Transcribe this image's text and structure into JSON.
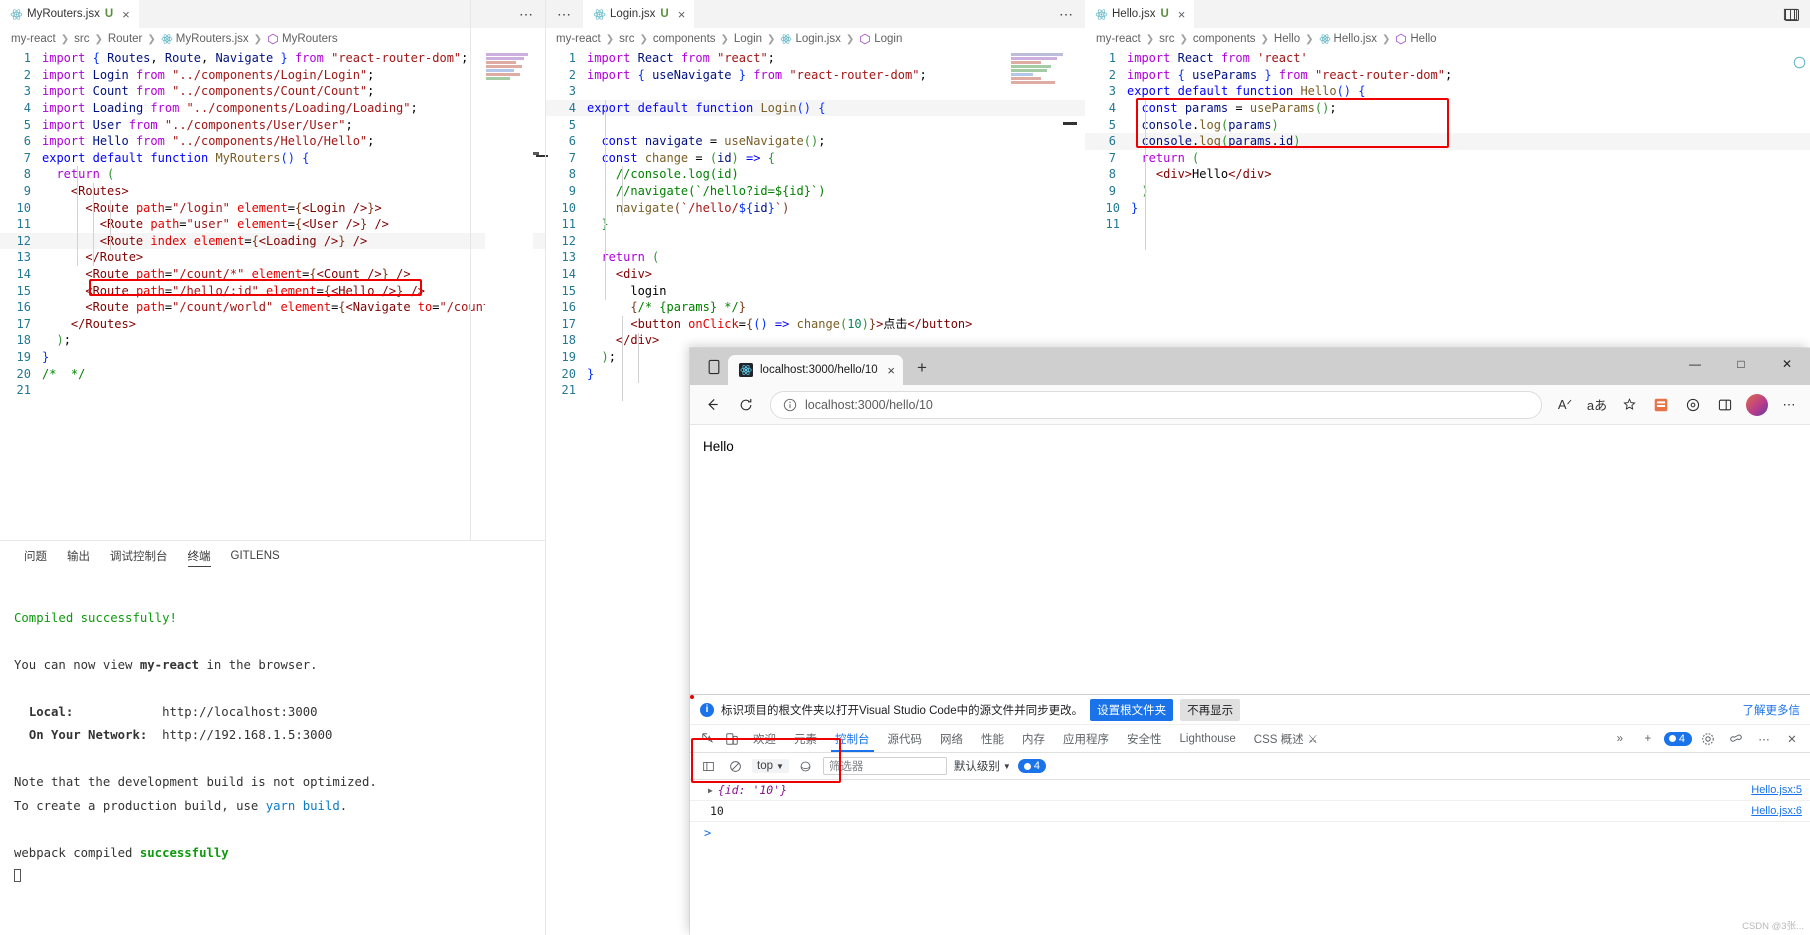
{
  "editor_groups": [
    {
      "id": "group-myrouters",
      "tab": {
        "filename": "MyRouters.jsx",
        "unsaved_marker": "U",
        "close": "×",
        "icon": "react-icon"
      },
      "more_actions": "⋯",
      "breadcrumb": [
        "my-react",
        "src",
        "Router",
        "MyRouters.jsx",
        "MyRouters"
      ],
      "lines": [
        "import { Routes, Route, Navigate } from \"react-router-dom\";",
        "import Login from \"../components/Login/Login\";",
        "import Count from \"../components/Count/Count\";",
        "import Loading from \"../components/Loading/Loading\";",
        "import User from \"../components/User/User\";",
        "import Hello from \"../components/Hello/Hello\";",
        "export default function MyRouters() {",
        "  return (",
        "    <Routes>",
        "      <Route path=\"/login\" element={<Login />}>",
        "        <Route path=\"user\" element={<User />} />",
        "        <Route index element={{<Loading />} />",
        "      </Route>",
        "      <Route path=\"/count/*\" element={<Count />} />",
        "      <Route path=\"/hello/:id\" element={<Hello />} />",
        "      <Route path=\"/count/world\" element={<Navigate to=\"/count",
        "    </Routes>",
        "  );",
        "}",
        "/*  */",
        ""
      ],
      "line_count": 21,
      "highlight_note": "line 15 red box"
    },
    {
      "id": "group-login",
      "tab": {
        "filename": "Login.jsx",
        "unsaved_marker": "U",
        "close": "×",
        "icon": "react-icon"
      },
      "more_actions": "⋯",
      "breadcrumb": [
        "my-react",
        "src",
        "components",
        "Login",
        "Login.jsx",
        "Login"
      ],
      "lines": [
        "import React from \"react\";",
        "import { useNavigate } from \"react-router-dom\";",
        "",
        "export default function Login() {",
        "",
        "  const navigate = useNavigate();",
        "  const change = (id) => {",
        "    //console.log(id)",
        "    //navigate(`/hello?id=${id}`)",
        "    navigate(`/hello/${id}`)",
        "  }",
        "",
        "  return (",
        "    <div>",
        "      login",
        "      {/* {params} */}",
        "      <button onClick={() => change(10)}>点击</button>",
        "    </div>",
        "  );",
        "}",
        ""
      ],
      "line_count": 21
    },
    {
      "id": "group-hello",
      "tab": {
        "filename": "Hello.jsx",
        "unsaved_marker": "U",
        "close": "×",
        "icon": "react-icon"
      },
      "breadcrumb": [
        "my-react",
        "src",
        "components",
        "Hello",
        "Hello.jsx",
        "Hello"
      ],
      "lines": [
        "import React from 'react'",
        "import { useParams } from \"react-router-dom\";",
        "export default function Hello() {",
        "  const params = useParams();",
        "  console.log(params)",
        "  console.log(params.id)",
        "  return (",
        "    <div>Hello</div>",
        "  )",
        "}",
        ""
      ],
      "line_count": 11,
      "highlight_note": "lines 4-6 red box"
    }
  ],
  "panel": {
    "tabs": [
      {
        "label": "问题",
        "active": false
      },
      {
        "label": "输出",
        "active": false
      },
      {
        "label": "调试控制台",
        "active": false
      },
      {
        "label": "终端",
        "active": true
      },
      {
        "label": "GITLENS",
        "active": false
      }
    ],
    "terminal_lines": [
      "Compiled successfully!",
      "",
      "You can now view my-react in the browser.",
      "",
      "  Local:            http://localhost:3000",
      "  On Your Network:  http://192.168.1.5:3000",
      "",
      "Note that the development build is not optimized.",
      "To create a production build, use yarn build.",
      "",
      "webpack compiled successfully"
    ],
    "terminal": {
      "compiled": "Compiled successfully!",
      "view_msg": "You can now view my-react in the browser.",
      "app_name": "my-react",
      "local_label": "Local:",
      "local_url": "http://localhost:3000",
      "network_label": "On Your Network:",
      "network_url": "http://192.168.1.5:3000",
      "note1": "Note that the development build is not optimized.",
      "note2_pre": "To create a production build, use ",
      "note2_cmd": "yarn build",
      "note2_post": ".",
      "webpack_pre": "webpack compiled ",
      "webpack_status": "successfully"
    }
  },
  "browser": {
    "tab": {
      "title": "localhost:3000/hello/10",
      "close": "×",
      "favicon": "react-icon"
    },
    "new_tab": "+",
    "window_controls": {
      "minimize": "—",
      "maximize": "□",
      "close": "✕"
    },
    "toolbar": {
      "back": "←",
      "reload": "↻",
      "info_icon": "info-icon",
      "url": "localhost:3000/hello/10",
      "read_aloud": "Aᐟ",
      "immersive": "aあ",
      "favorite": "☆",
      "collections": "collections-icon",
      "browser_essentials": "essentials-icon",
      "split": "split-screen-icon",
      "profile": "avatar",
      "more": "⋯"
    },
    "page_text": "Hello",
    "devtools": {
      "banner": {
        "message": "标识项目的根文件夹以打开Visual Studio Code中的源文件并同步更改。",
        "primary_btn": "设置根文件夹",
        "secondary_btn": "不再显示",
        "learn_more": "了解更多信"
      },
      "tabs": [
        {
          "label": "欢迎",
          "active": false
        },
        {
          "label": "元素",
          "active": false
        },
        {
          "label": "控制台",
          "active": true
        },
        {
          "label": "源代码",
          "active": false
        },
        {
          "label": "网络",
          "active": false
        },
        {
          "label": "性能",
          "active": false
        },
        {
          "label": "内存",
          "active": false
        },
        {
          "label": "应用程序",
          "active": false
        },
        {
          "label": "安全性",
          "active": false
        },
        {
          "label": "Lighthouse",
          "active": false
        },
        {
          "label": "CSS 概述",
          "active": false
        }
      ],
      "tabs_overflow": "»",
      "tabs_add": "+",
      "issue_count": "4",
      "filterbar": {
        "context": "top",
        "filter_placeholder": "筛选器",
        "level": "默认级别",
        "count": "4"
      },
      "console_rows": [
        {
          "expand": "▶",
          "text": "{id: '10'}",
          "source": "Hello.jsx:5",
          "kind": "object"
        },
        {
          "expand": "",
          "text": "10",
          "source": "Hello.jsx:6",
          "kind": "value"
        }
      ],
      "prompt": ">"
    }
  },
  "watermark": "CSDN @3张..."
}
